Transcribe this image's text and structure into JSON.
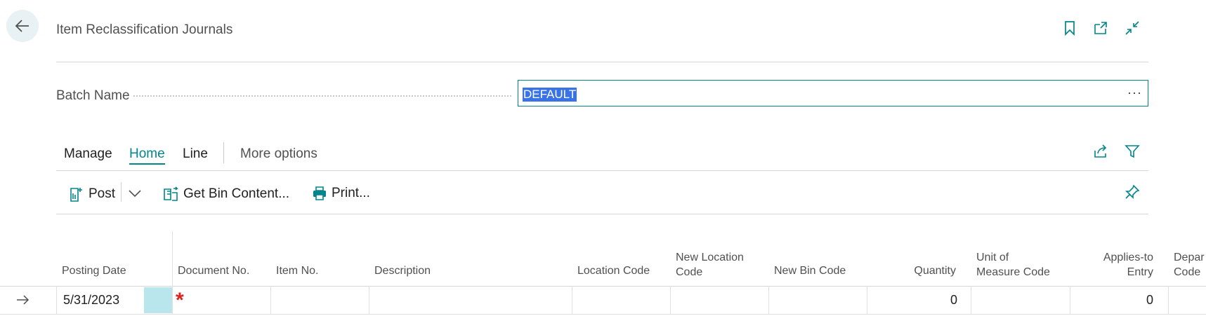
{
  "header": {
    "title": "Item Reclassification Journals"
  },
  "batch": {
    "label": "Batch Name",
    "value": "DEFAULT",
    "more": "···"
  },
  "tabs": {
    "manage": "Manage",
    "home": "Home",
    "line": "Line",
    "more": "More options"
  },
  "commands": {
    "post": "Post",
    "get_bin": "Get Bin Content...",
    "print": "Print..."
  },
  "columns": {
    "posting_date": "Posting Date",
    "document_no": "Document No.",
    "item_no": "Item No.",
    "description": "Description",
    "location_code": "Location Code",
    "new_location_code_1": "New Location",
    "new_location_code_2": "Code",
    "new_bin_code": "New Bin Code",
    "quantity": "Quantity",
    "uom_1": "Unit of",
    "uom_2": "Measure Code",
    "applies_1": "Applies-to",
    "applies_2": "Entry",
    "dept_1": "Depar",
    "dept_2": "Code"
  },
  "row": {
    "posting_date": "5/31/2023",
    "required_marker": "*",
    "quantity": "0",
    "applies_to_entry": "0"
  },
  "colors": {
    "accent": "#00868b",
    "selection": "#3a73e6",
    "required": "#e02020"
  }
}
